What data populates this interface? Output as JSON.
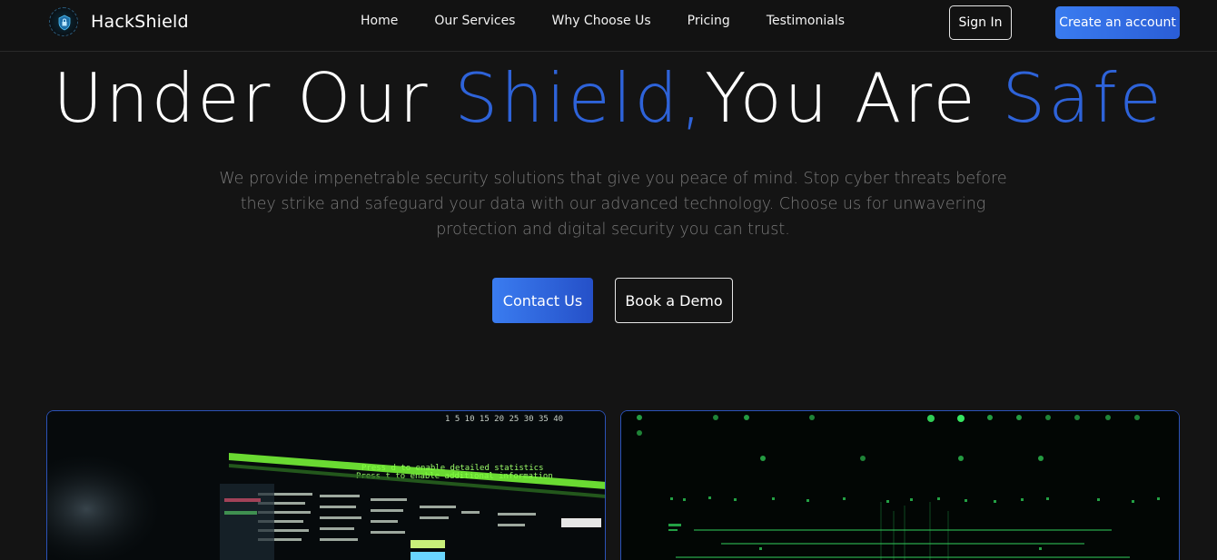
{
  "brand": {
    "name": "HackShield",
    "logo_icon": "shield-lock-icon"
  },
  "nav": {
    "items": [
      {
        "label": "Home"
      },
      {
        "label": "Our Services"
      },
      {
        "label": "Why Choose Us"
      },
      {
        "label": "Pricing"
      },
      {
        "label": "Testimonials"
      }
    ],
    "sign_in": "Sign In",
    "create_account": "Create an account"
  },
  "hero": {
    "title_part1": "Under Our ",
    "title_part2": "Shield,",
    "title_part3": "You Are ",
    "title_part4": "Safe",
    "subtitle": "We provide impenetrable security solutions that give you peace of mind. Stop cyber threats before they strike and safeguard your data with our advanced technology. Choose us for unwavering protection and digital security you can trust.",
    "contact_label": "Contact Us",
    "demo_label": "Book a Demo"
  },
  "colors": {
    "accent": "#2e63d9",
    "button_gradient_start": "#3a7cf0",
    "background": "#141414",
    "subtitle": "#7a7a7a"
  },
  "images": {
    "left_terminal_lines": [
      "Press d to enable detailed statistics",
      "Press t to enable additional information",
      "1   5   10   15   20   25   30   35   40"
    ]
  }
}
